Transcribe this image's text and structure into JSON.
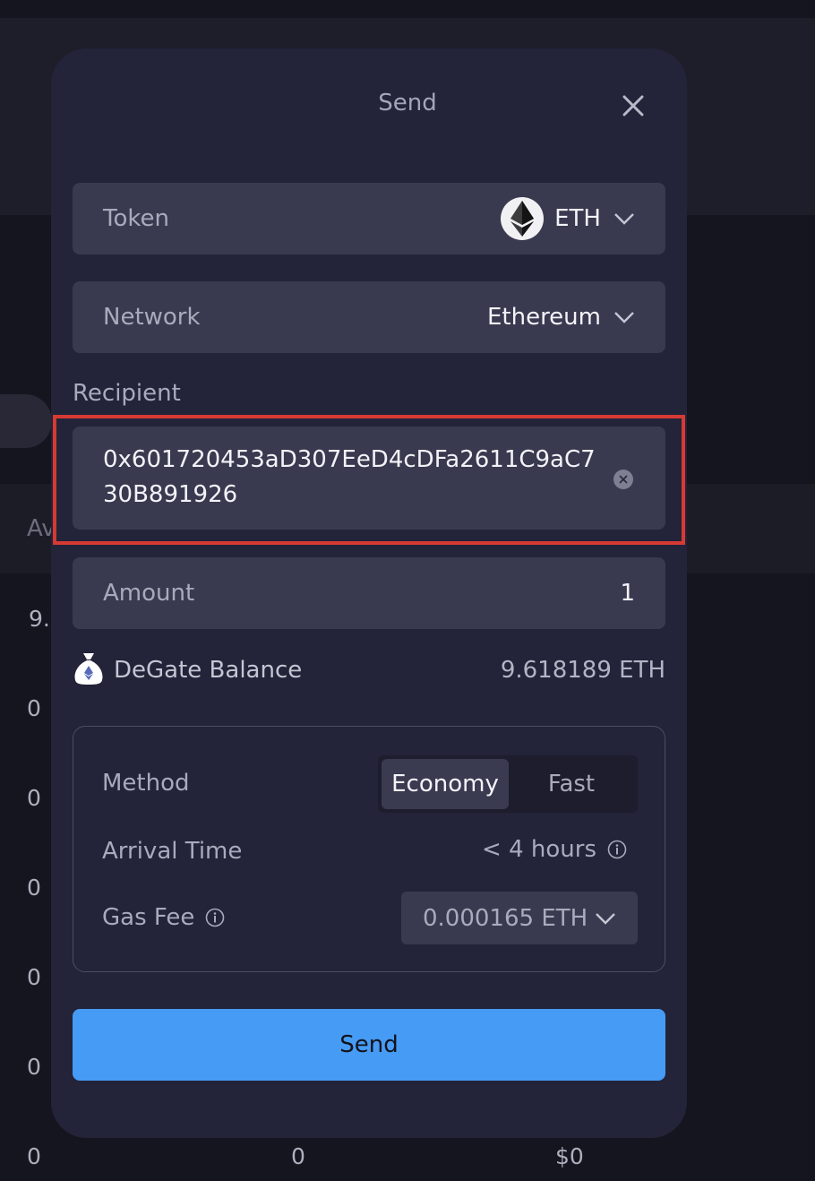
{
  "background": {
    "av_text": "Av",
    "col1_values": [
      "9.",
      "0",
      "0",
      "0",
      "0",
      "0",
      "0"
    ],
    "bottom_row": {
      "col2": "0",
      "col3": "$0"
    }
  },
  "modal": {
    "title": "Send",
    "token": {
      "label": "Token",
      "value": "ETH",
      "icon": "ethereum-logo-icon"
    },
    "network": {
      "label": "Network",
      "value": "Ethereum"
    },
    "recipient": {
      "label": "Recipient",
      "address": "0x601720453aD307EeD4cDFa2611C9aC730B891926"
    },
    "amount": {
      "label": "Amount",
      "value": "1"
    },
    "balance": {
      "label": "DeGate Balance",
      "value": "9.618189 ETH",
      "icon": "money-bag-icon"
    },
    "method": {
      "label": "Method",
      "options": [
        "Economy",
        "Fast"
      ],
      "selected": "Economy"
    },
    "arrival": {
      "label": "Arrival Time",
      "value": "< 4 hours"
    },
    "gas_fee": {
      "label": "Gas Fee",
      "value": "0.000165 ETH"
    },
    "send_button": "Send"
  },
  "colors": {
    "modal_bg": "#232339",
    "field_bg": "#393a4f",
    "accent_blue": "#469bf5",
    "highlight_red": "#d63a33"
  }
}
